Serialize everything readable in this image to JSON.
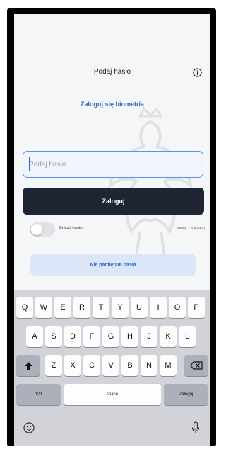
{
  "header": {
    "title": "Podaj hasło"
  },
  "biometric_link": "Zaloguj się biometrią",
  "password": {
    "placeholder": "Podaj hasło",
    "value": ""
  },
  "login_button": "Zaloguj",
  "show_password": {
    "label": "Pokaż hasło",
    "checked": false
  },
  "version": "wersja 2.3.4 (549)",
  "forgot_button": "Nie pamiętam hasła",
  "keyboard": {
    "row1": [
      "Q",
      "W",
      "E",
      "R",
      "T",
      "Y",
      "U",
      "I",
      "O",
      "P"
    ],
    "row2": [
      "A",
      "S",
      "D",
      "F",
      "G",
      "H",
      "J",
      "K",
      "L"
    ],
    "row3": [
      "Z",
      "X",
      "C",
      "V",
      "B",
      "N",
      "M"
    ],
    "numbers_label": "123",
    "space_label": "space",
    "return_label": "Zaloguj"
  },
  "colors": {
    "accent": "#2f64c8",
    "primary_button": "#1f2533",
    "background": "#f5f6f8"
  },
  "icons": [
    "info-icon",
    "shift-icon",
    "backspace-icon",
    "emoji-icon",
    "microphone-icon",
    "emblem-watermark"
  ]
}
